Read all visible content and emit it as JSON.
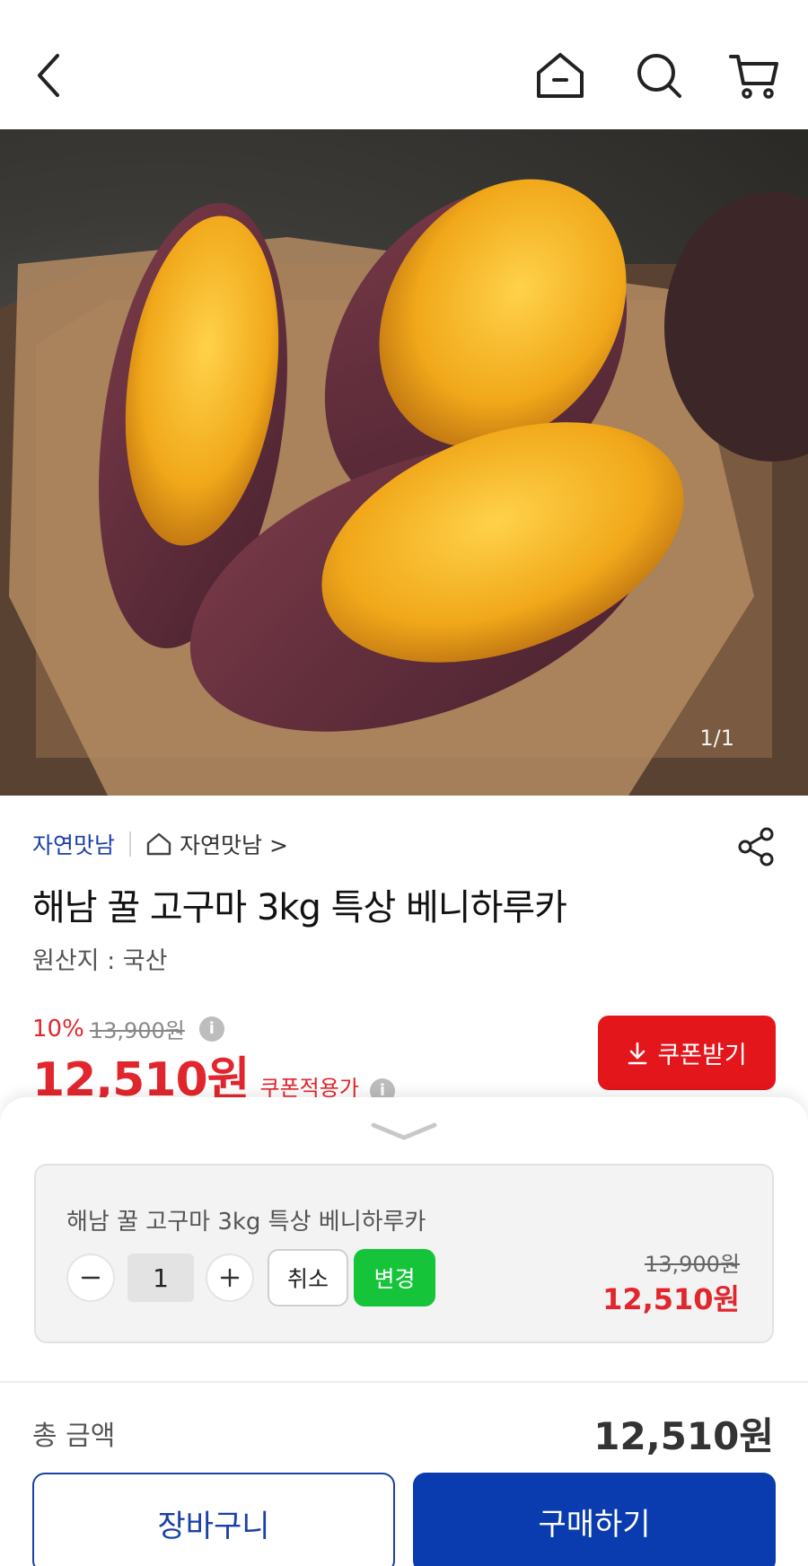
{
  "header": {
    "back_icon": "chevron-left-icon",
    "home_icon": "home-icon",
    "search_icon": "search-icon",
    "cart_icon": "cart-icon"
  },
  "gallery": {
    "counter": "1/1"
  },
  "product": {
    "store_name": "자연맛남",
    "store_link": "자연맛남 >",
    "title": "해남 꿀 고구마 3kg 특상 베니하루카",
    "origin": "원산지 : 국산",
    "discount": "10%",
    "original_price": "13,900원",
    "price": "12,510원",
    "coupon_applied_label": "쿠폰적용가",
    "coupon_button": "쿠폰받기"
  },
  "sheet": {
    "option_name": "해남 꿀 고구마 3kg 특상 베니하루카",
    "quantity": "1",
    "cancel_label": "취소",
    "change_label": "변경",
    "option_original_price": "13,900원",
    "option_price": "12,510원",
    "total_label": "총 금액",
    "total_amount": "12,510원",
    "cart_button": "장바구니",
    "buy_button": "구매하기"
  },
  "colors": {
    "accent_red": "#e1262d",
    "brand_blue": "#0a3cb0",
    "change_green": "#16c43a"
  }
}
